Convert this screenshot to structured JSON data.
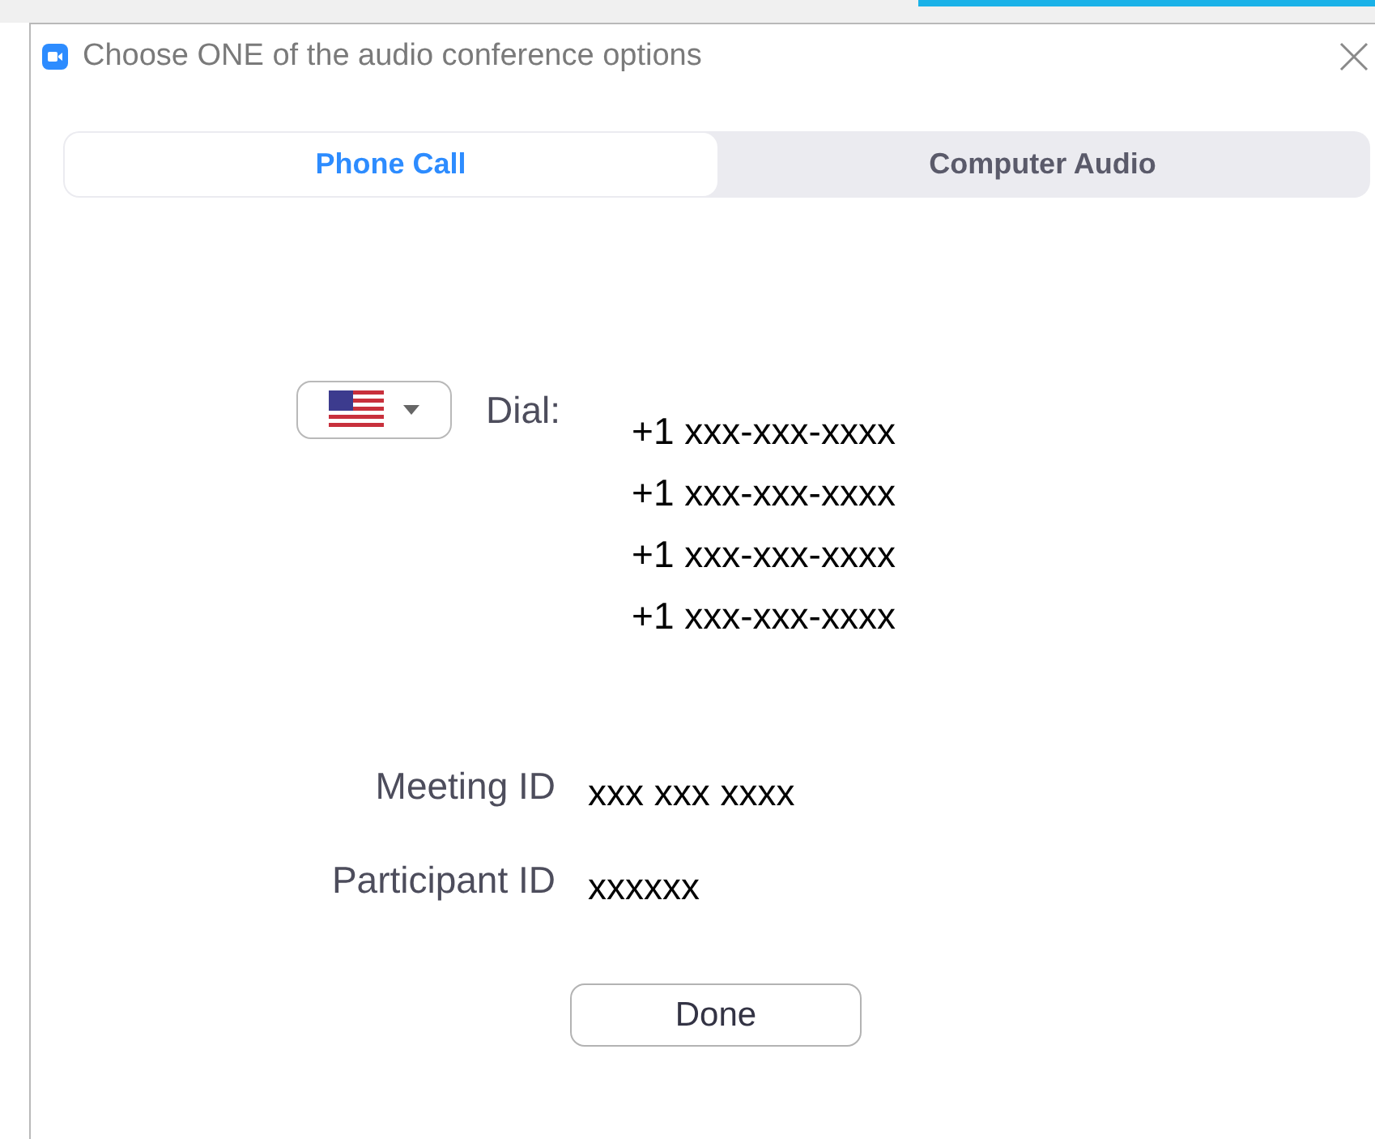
{
  "window": {
    "title": "Choose ONE of the audio conference options"
  },
  "tabs": [
    {
      "label": "Phone Call",
      "selected": true
    },
    {
      "label": "Computer Audio",
      "selected": false
    }
  ],
  "dial": {
    "label": "Dial:",
    "numbers": [
      "+1 xxx-xxx-xxxx",
      "+1 xxx-xxx-xxxx",
      "+1 xxx-xxx-xxxx",
      "+1 xxx-xxx-xxxx"
    ]
  },
  "fields": [
    {
      "label": "Meeting ID",
      "value": "xxx xxx xxxx"
    },
    {
      "label": "Participant ID",
      "value": "xxxxxx"
    }
  ],
  "buttons": [
    "Done"
  ]
}
